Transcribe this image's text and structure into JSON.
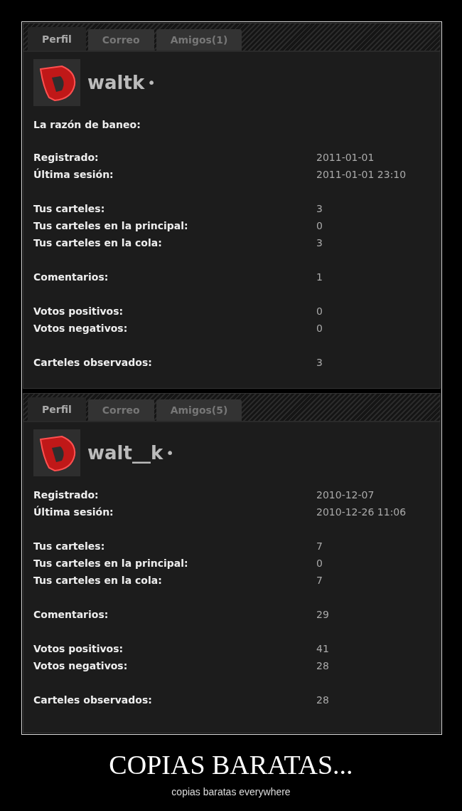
{
  "panels": [
    {
      "tabs": [
        {
          "label": "Perfil",
          "selected": true
        },
        {
          "label": "Correo",
          "selected": false
        },
        {
          "label": "Amigos(1)",
          "selected": false
        }
      ],
      "username": "waltk",
      "status_mark": "•",
      "ban_reason": "La razón de baneo:",
      "groups": [
        [
          {
            "label": "Registrado:",
            "value": "2011-01-01"
          },
          {
            "label": "Última sesión:",
            "value": "2011-01-01 23:10"
          }
        ],
        [
          {
            "label": "Tus carteles:",
            "value": "3"
          },
          {
            "label": "Tus carteles en la principal:",
            "value": "0"
          },
          {
            "label": "Tus carteles en la cola:",
            "value": "3"
          }
        ],
        [
          {
            "label": "Comentarios:",
            "value": "1"
          }
        ],
        [
          {
            "label": "Votos positivos:",
            "value": "0"
          },
          {
            "label": "Votos negativos:",
            "value": "0"
          }
        ],
        [
          {
            "label": "Carteles observados:",
            "value": "3"
          }
        ]
      ]
    },
    {
      "tabs": [
        {
          "label": "Perfil",
          "selected": true
        },
        {
          "label": "Correo",
          "selected": false
        },
        {
          "label": "Amigos(5)",
          "selected": false
        }
      ],
      "username": "walt__k",
      "status_mark": "•",
      "groups": [
        [
          {
            "label": "Registrado:",
            "value": "2010-12-07"
          },
          {
            "label": "Última sesión:",
            "value": "2010-12-26 11:06"
          }
        ],
        [
          {
            "label": "Tus carteles:",
            "value": "7"
          },
          {
            "label": "Tus carteles en la principal:",
            "value": "0"
          },
          {
            "label": "Tus carteles en la cola:",
            "value": "7"
          }
        ],
        [
          {
            "label": "Comentarios:",
            "value": "29"
          }
        ],
        [
          {
            "label": "Votos positivos:",
            "value": "41"
          },
          {
            "label": "Votos negativos:",
            "value": "28"
          }
        ],
        [
          {
            "label": "Carteles observados:",
            "value": "28"
          }
        ]
      ]
    }
  ],
  "poster": {
    "title": "COPIAS BARATAS...",
    "subtitle": "copias baratas everywhere"
  }
}
